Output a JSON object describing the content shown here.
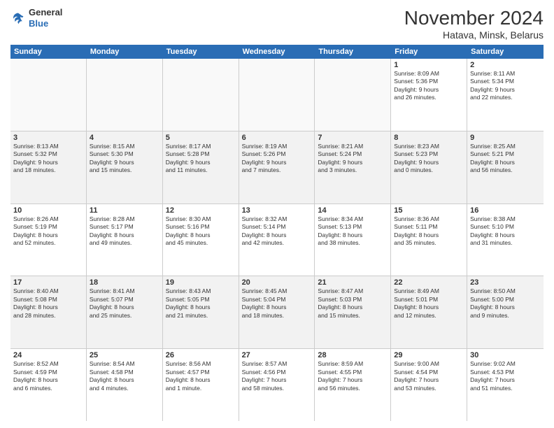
{
  "logo": {
    "general": "General",
    "blue": "Blue"
  },
  "title": "November 2024",
  "subtitle": "Hatava, Minsk, Belarus",
  "weekdays": [
    "Sunday",
    "Monday",
    "Tuesday",
    "Wednesday",
    "Thursday",
    "Friday",
    "Saturday"
  ],
  "rows": [
    [
      {
        "day": "",
        "info": "",
        "empty": true
      },
      {
        "day": "",
        "info": "",
        "empty": true
      },
      {
        "day": "",
        "info": "",
        "empty": true
      },
      {
        "day": "",
        "info": "",
        "empty": true
      },
      {
        "day": "",
        "info": "",
        "empty": true
      },
      {
        "day": "1",
        "info": "Sunrise: 8:09 AM\nSunset: 5:36 PM\nDaylight: 9 hours\nand 26 minutes.",
        "empty": false
      },
      {
        "day": "2",
        "info": "Sunrise: 8:11 AM\nSunset: 5:34 PM\nDaylight: 9 hours\nand 22 minutes.",
        "empty": false
      }
    ],
    [
      {
        "day": "3",
        "info": "Sunrise: 8:13 AM\nSunset: 5:32 PM\nDaylight: 9 hours\nand 18 minutes.",
        "empty": false
      },
      {
        "day": "4",
        "info": "Sunrise: 8:15 AM\nSunset: 5:30 PM\nDaylight: 9 hours\nand 15 minutes.",
        "empty": false
      },
      {
        "day": "5",
        "info": "Sunrise: 8:17 AM\nSunset: 5:28 PM\nDaylight: 9 hours\nand 11 minutes.",
        "empty": false
      },
      {
        "day": "6",
        "info": "Sunrise: 8:19 AM\nSunset: 5:26 PM\nDaylight: 9 hours\nand 7 minutes.",
        "empty": false
      },
      {
        "day": "7",
        "info": "Sunrise: 8:21 AM\nSunset: 5:24 PM\nDaylight: 9 hours\nand 3 minutes.",
        "empty": false
      },
      {
        "day": "8",
        "info": "Sunrise: 8:23 AM\nSunset: 5:23 PM\nDaylight: 9 hours\nand 0 minutes.",
        "empty": false
      },
      {
        "day": "9",
        "info": "Sunrise: 8:25 AM\nSunset: 5:21 PM\nDaylight: 8 hours\nand 56 minutes.",
        "empty": false
      }
    ],
    [
      {
        "day": "10",
        "info": "Sunrise: 8:26 AM\nSunset: 5:19 PM\nDaylight: 8 hours\nand 52 minutes.",
        "empty": false
      },
      {
        "day": "11",
        "info": "Sunrise: 8:28 AM\nSunset: 5:17 PM\nDaylight: 8 hours\nand 49 minutes.",
        "empty": false
      },
      {
        "day": "12",
        "info": "Sunrise: 8:30 AM\nSunset: 5:16 PM\nDaylight: 8 hours\nand 45 minutes.",
        "empty": false
      },
      {
        "day": "13",
        "info": "Sunrise: 8:32 AM\nSunset: 5:14 PM\nDaylight: 8 hours\nand 42 minutes.",
        "empty": false
      },
      {
        "day": "14",
        "info": "Sunrise: 8:34 AM\nSunset: 5:13 PM\nDaylight: 8 hours\nand 38 minutes.",
        "empty": false
      },
      {
        "day": "15",
        "info": "Sunrise: 8:36 AM\nSunset: 5:11 PM\nDaylight: 8 hours\nand 35 minutes.",
        "empty": false
      },
      {
        "day": "16",
        "info": "Sunrise: 8:38 AM\nSunset: 5:10 PM\nDaylight: 8 hours\nand 31 minutes.",
        "empty": false
      }
    ],
    [
      {
        "day": "17",
        "info": "Sunrise: 8:40 AM\nSunset: 5:08 PM\nDaylight: 8 hours\nand 28 minutes.",
        "empty": false
      },
      {
        "day": "18",
        "info": "Sunrise: 8:41 AM\nSunset: 5:07 PM\nDaylight: 8 hours\nand 25 minutes.",
        "empty": false
      },
      {
        "day": "19",
        "info": "Sunrise: 8:43 AM\nSunset: 5:05 PM\nDaylight: 8 hours\nand 21 minutes.",
        "empty": false
      },
      {
        "day": "20",
        "info": "Sunrise: 8:45 AM\nSunset: 5:04 PM\nDaylight: 8 hours\nand 18 minutes.",
        "empty": false
      },
      {
        "day": "21",
        "info": "Sunrise: 8:47 AM\nSunset: 5:03 PM\nDaylight: 8 hours\nand 15 minutes.",
        "empty": false
      },
      {
        "day": "22",
        "info": "Sunrise: 8:49 AM\nSunset: 5:01 PM\nDaylight: 8 hours\nand 12 minutes.",
        "empty": false
      },
      {
        "day": "23",
        "info": "Sunrise: 8:50 AM\nSunset: 5:00 PM\nDaylight: 8 hours\nand 9 minutes.",
        "empty": false
      }
    ],
    [
      {
        "day": "24",
        "info": "Sunrise: 8:52 AM\nSunset: 4:59 PM\nDaylight: 8 hours\nand 6 minutes.",
        "empty": false
      },
      {
        "day": "25",
        "info": "Sunrise: 8:54 AM\nSunset: 4:58 PM\nDaylight: 8 hours\nand 4 minutes.",
        "empty": false
      },
      {
        "day": "26",
        "info": "Sunrise: 8:56 AM\nSunset: 4:57 PM\nDaylight: 8 hours\nand 1 minute.",
        "empty": false
      },
      {
        "day": "27",
        "info": "Sunrise: 8:57 AM\nSunset: 4:56 PM\nDaylight: 7 hours\nand 58 minutes.",
        "empty": false
      },
      {
        "day": "28",
        "info": "Sunrise: 8:59 AM\nSunset: 4:55 PM\nDaylight: 7 hours\nand 56 minutes.",
        "empty": false
      },
      {
        "day": "29",
        "info": "Sunrise: 9:00 AM\nSunset: 4:54 PM\nDaylight: 7 hours\nand 53 minutes.",
        "empty": false
      },
      {
        "day": "30",
        "info": "Sunrise: 9:02 AM\nSunset: 4:53 PM\nDaylight: 7 hours\nand 51 minutes.",
        "empty": false
      }
    ]
  ]
}
